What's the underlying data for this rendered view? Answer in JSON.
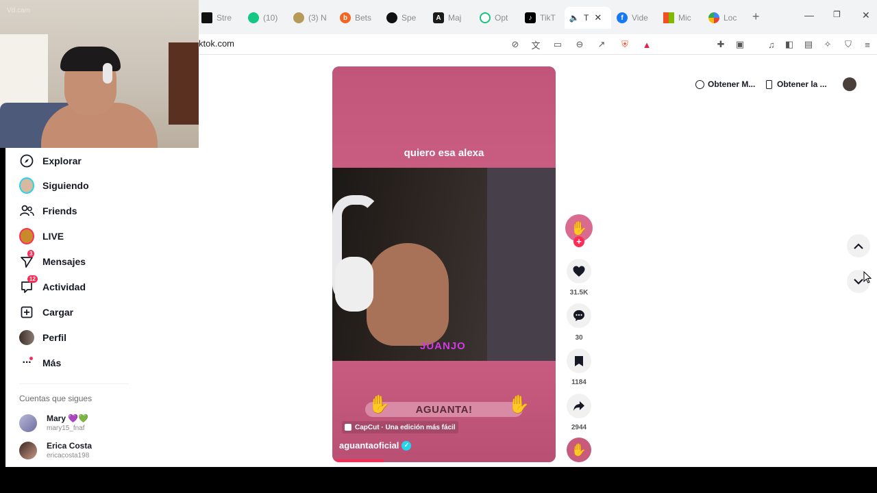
{
  "browser": {
    "tabs": [
      {
        "label": "Stre",
        "icon": "twitch-like-icon",
        "color": "#111111"
      },
      {
        "label": "(10)",
        "icon": "chat-icon",
        "color": "#16c784"
      },
      {
        "label": "(3) N",
        "icon": "globe-icon",
        "color": "#b59b57"
      },
      {
        "label": "Bets",
        "icon": "b-icon",
        "color": "#f26522"
      },
      {
        "label": "Spe",
        "icon": "speedometer-icon",
        "color": "#111111"
      },
      {
        "label": "Maj",
        "icon": "a-icon",
        "color": "#1a1a1a"
      },
      {
        "label": "Opt",
        "icon": "o-icon",
        "color": "#19c37d"
      },
      {
        "label": "TikT",
        "icon": "tiktok-icon",
        "color": "#000000"
      },
      {
        "label": "T",
        "icon": "speaker-icon",
        "color": "#333333",
        "active": true
      },
      {
        "label": "Vide",
        "icon": "facebook-icon",
        "color": "#1877f2"
      },
      {
        "label": "Mic",
        "icon": "microsoft-icon",
        "color": "#f25022"
      },
      {
        "label": "Loc",
        "icon": "pinwheel-icon",
        "color": "#4285f4"
      }
    ],
    "close_glyph": "✕",
    "new_tab_glyph": "+",
    "url": "ktok.com"
  },
  "webcam": {
    "watermark": "Vd.cam"
  },
  "sidebar": {
    "items": [
      {
        "label": "Explorar",
        "icon": "compass-icon"
      },
      {
        "label": "Siguiendo",
        "icon": "avatar-icon"
      },
      {
        "label": "Friends",
        "icon": "friends-icon"
      },
      {
        "label": "LIVE",
        "icon": "live-icon"
      },
      {
        "label": "Mensajes",
        "icon": "send-icon",
        "badge": "3"
      },
      {
        "label": "Actividad",
        "icon": "inbox-icon",
        "badge": "12"
      },
      {
        "label": "Cargar",
        "icon": "upload-icon"
      },
      {
        "label": "Perfil",
        "icon": "profile-icon"
      },
      {
        "label": "Más",
        "icon": "more-icon"
      }
    ],
    "following_title": "Cuentas que sigues",
    "following": [
      {
        "name": "Mary 💜💚",
        "username": "mary15_fnaf"
      },
      {
        "name": "Erica Costa",
        "username": "ericacosta198"
      }
    ]
  },
  "video": {
    "caption_top": "quiero esa alexa",
    "overlay_name": "JUANJO",
    "banner": "AGUANTA!",
    "capcut": "CapCut · Una edición más fácil",
    "author": "aguantaoficial",
    "progress": 0.23
  },
  "actions": {
    "likes": "31.5K",
    "comments": "30",
    "saves": "1184",
    "shares": "2944"
  },
  "header": {
    "pill_1": "Obtener M...",
    "pill_2": "Obtener la ..."
  },
  "colors": {
    "accent": "#fe2c55",
    "video_pink": "#c85a7c",
    "verified": "#20d5ec"
  }
}
